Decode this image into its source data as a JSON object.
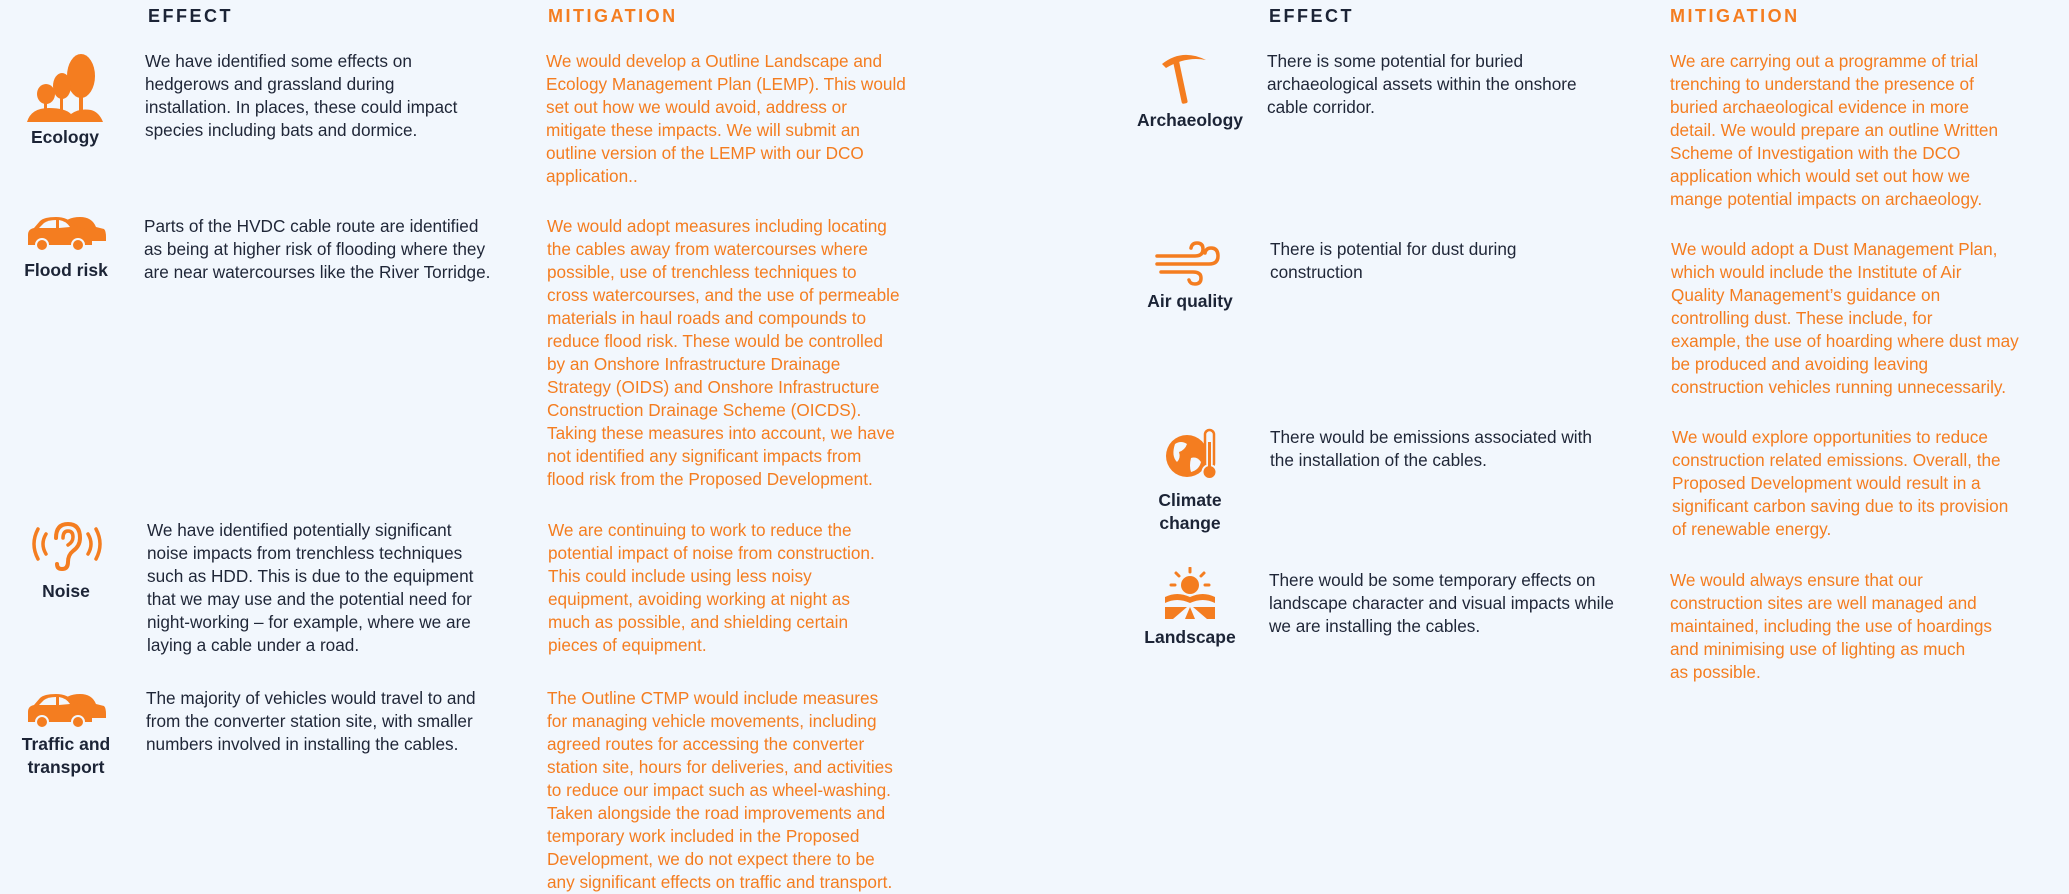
{
  "left_column": {
    "effect_heading": "EFFECT",
    "mitigation_heading": "MITIGATION",
    "rows": [
      {
        "topic": [
          "Ecology"
        ],
        "icon": "trees-icon",
        "effect": [
          "We have identified some effects on",
          "hedgerows and grassland during",
          "installation. In places, these could impact",
          "species including bats and dormice."
        ],
        "mitigation": [
          "We would develop a Outline Landscape and",
          "Ecology Management Plan (LEMP). This would",
          "set out how we would avoid, address or",
          "mitigate these impacts. We will submit an",
          "outline version of the LEMP with our DCO",
          "application.."
        ]
      },
      {
        "topic": [
          "Flood risk"
        ],
        "icon": "cars-icon",
        "effect": [
          "Parts of the HVDC cable route are identified",
          "as being at higher risk of flooding where they",
          "are near watercourses like the River Torridge."
        ],
        "mitigation": [
          "We would adopt measures including locating",
          "the cables away from watercourses where",
          "possible, use of trenchless techniques to",
          "cross watercourses, and the use of permeable",
          "materials in haul roads and compounds to",
          "reduce flood risk. These would be controlled",
          "by an Onshore Infrastructure Drainage",
          "Strategy (OIDS) and Onshore Infrastructure",
          "Construction Drainage Scheme (OICDS).",
          "Taking these measures into account, we have",
          "not identified any significant impacts from",
          "flood risk from the Proposed Development."
        ]
      },
      {
        "topic": [
          "Noise"
        ],
        "icon": "ear-icon",
        "effect": [
          "We have identified potentially significant",
          "noise impacts from trenchless techniques",
          "such as HDD. This is due to the equipment",
          "that we may use and the potential need for",
          "night-working – for example, where we are",
          "laying a cable under a road."
        ],
        "mitigation": [
          "We are continuing to work to reduce the",
          "potential impact of noise from construction.",
          "This could include using less noisy",
          "equipment, avoiding working at night as",
          "much as possible, and shielding certain",
          "pieces of equipment."
        ]
      },
      {
        "topic": [
          "Traffic and",
          "transport"
        ],
        "icon": "cars-icon",
        "effect": [
          "The majority of vehicles would travel to and",
          "from the converter station site, with smaller",
          "numbers involved in installing the cables."
        ],
        "mitigation": [
          "The Outline CTMP would include measures",
          "for managing vehicle movements, including",
          "agreed routes for accessing the converter",
          "station site, hours for deliveries, and activities",
          "to reduce our impact such as wheel-washing.",
          "Taken alongside the road improvements and",
          "temporary work included in the Proposed",
          "Development, we do not expect there to be",
          "any significant effects on traffic and transport."
        ]
      }
    ]
  },
  "right_column": {
    "effect_heading": "EFFECT",
    "mitigation_heading": "MITIGATION",
    "rows": [
      {
        "topic": [
          "Archaeology"
        ],
        "icon": "pickaxe-icon",
        "effect": [
          "There is some potential for buried",
          "archaeological assets within the onshore",
          "cable corridor."
        ],
        "mitigation": [
          "We are carrying out a programme of trial",
          "trenching to understand the presence of",
          "buried archaeological evidence in more",
          "detail. We would prepare an outline Written",
          "Scheme of Investigation with the DCO",
          "application which would set out how we",
          "mange potential impacts on archaeology."
        ]
      },
      {
        "topic": [
          "Air quality"
        ],
        "icon": "wind-icon",
        "effect": [
          "There is potential for dust during",
          "construction"
        ],
        "mitigation": [
          "We would adopt a Dust Management Plan,",
          "which would include the Institute of Air",
          "Quality Management’s guidance on",
          "controlling dust. These include, for",
          "example, the use of hoarding where dust may",
          "be produced and avoiding leaving",
          "construction vehicles running unnecessarily."
        ]
      },
      {
        "topic": [
          "Climate",
          "change"
        ],
        "icon": "globe-thermometer-icon",
        "effect": [
          "There would be emissions associated with",
          "the installation of the cables."
        ],
        "mitigation": [
          "We would explore opportunities to reduce",
          "construction related emissions. Overall, the",
          "Proposed Development would result in a",
          "significant carbon saving due to its provision",
          "of renewable energy."
        ]
      },
      {
        "topic": [
          "Landscape"
        ],
        "icon": "sun-landscape-icon",
        "effect": [
          "There would be some temporary effects on",
          "landscape character and visual impacts while",
          "we are installing the cables."
        ],
        "mitigation": [
          "We would always ensure that our",
          "construction sites are well managed and",
          "maintained, including the use of hoardings",
          "and minimising use of lighting as much",
          "as possible."
        ]
      }
    ]
  },
  "colors": {
    "accent": "#f47d20",
    "text": "#1f2637",
    "background": "#f2f7fd"
  }
}
